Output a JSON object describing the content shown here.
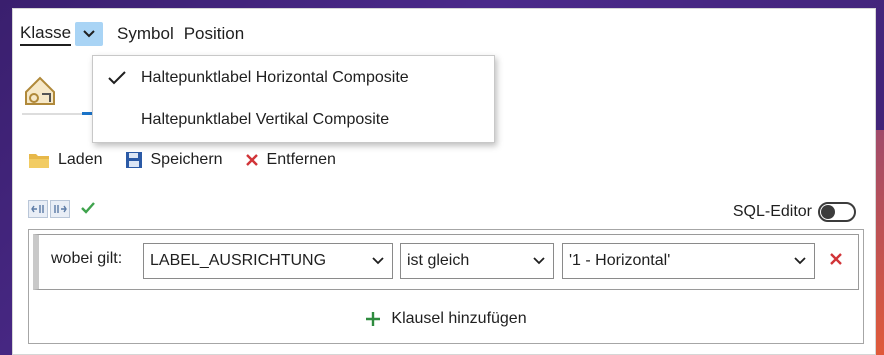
{
  "tabs": {
    "class_label": "Klasse",
    "symbol_label": "Symbol",
    "position_label": "Position"
  },
  "class_menu": {
    "items": [
      {
        "label": "Haltepunktlabel Horizontal Composite",
        "checked": true
      },
      {
        "label": "Haltepunktlabel Vertikal Composite",
        "checked": false
      }
    ]
  },
  "toolbar": {
    "load_label": "Laden",
    "save_label": "Speichern",
    "remove_label": "Entfernen"
  },
  "sql_editor": {
    "label": "SQL-Editor",
    "enabled": false
  },
  "clause": {
    "prefix": "wobei gilt:",
    "field_value": "LABEL_AUSRICHTUNG",
    "operator_value": "ist gleich",
    "value_value": "'1 - Horizontal'"
  },
  "add_clause_label": "Klausel hinzufügen",
  "colors": {
    "accent_blue": "#1a73c8",
    "remove_red": "#d13438",
    "add_green": "#2e8b3e",
    "check_green": "#3fa34d"
  }
}
